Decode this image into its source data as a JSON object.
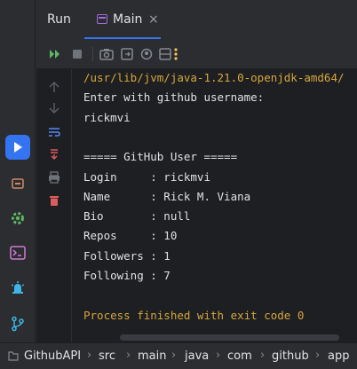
{
  "panel": {
    "title": "Run",
    "tab": {
      "label": "Main",
      "close_glyph": "×"
    }
  },
  "console": {
    "lines": [
      {
        "text": "/usr/lib/jvm/java-1.21.0-openjdk-amd64/",
        "kind": "cmd"
      },
      {
        "text": "Enter with github username:",
        "kind": "out"
      },
      {
        "text": "rickmvi",
        "kind": "out"
      },
      {
        "text": "",
        "kind": "out"
      },
      {
        "text": "===== GitHub User =====",
        "kind": "out"
      },
      {
        "text": "Login     : rickmvi",
        "kind": "out"
      },
      {
        "text": "Name      : Rick M. Viana",
        "kind": "out"
      },
      {
        "text": "Bio       : null",
        "kind": "out"
      },
      {
        "text": "Repos     : 10",
        "kind": "out"
      },
      {
        "text": "Followers : 1",
        "kind": "out"
      },
      {
        "text": "Following : 7",
        "kind": "out"
      },
      {
        "text": "",
        "kind": "out"
      },
      {
        "text": "Process finished with exit code 0",
        "kind": "done"
      }
    ]
  },
  "breadcrumb": [
    "GithubAPI",
    "src",
    "main",
    "java",
    "com",
    "github",
    "app"
  ],
  "colors": {
    "accent": "#3574f0",
    "command_text": "#d5a73b",
    "rerun_green": "#5fb865",
    "stop_red": "#db5c5c",
    "more_yellow": "#f2c55c"
  }
}
